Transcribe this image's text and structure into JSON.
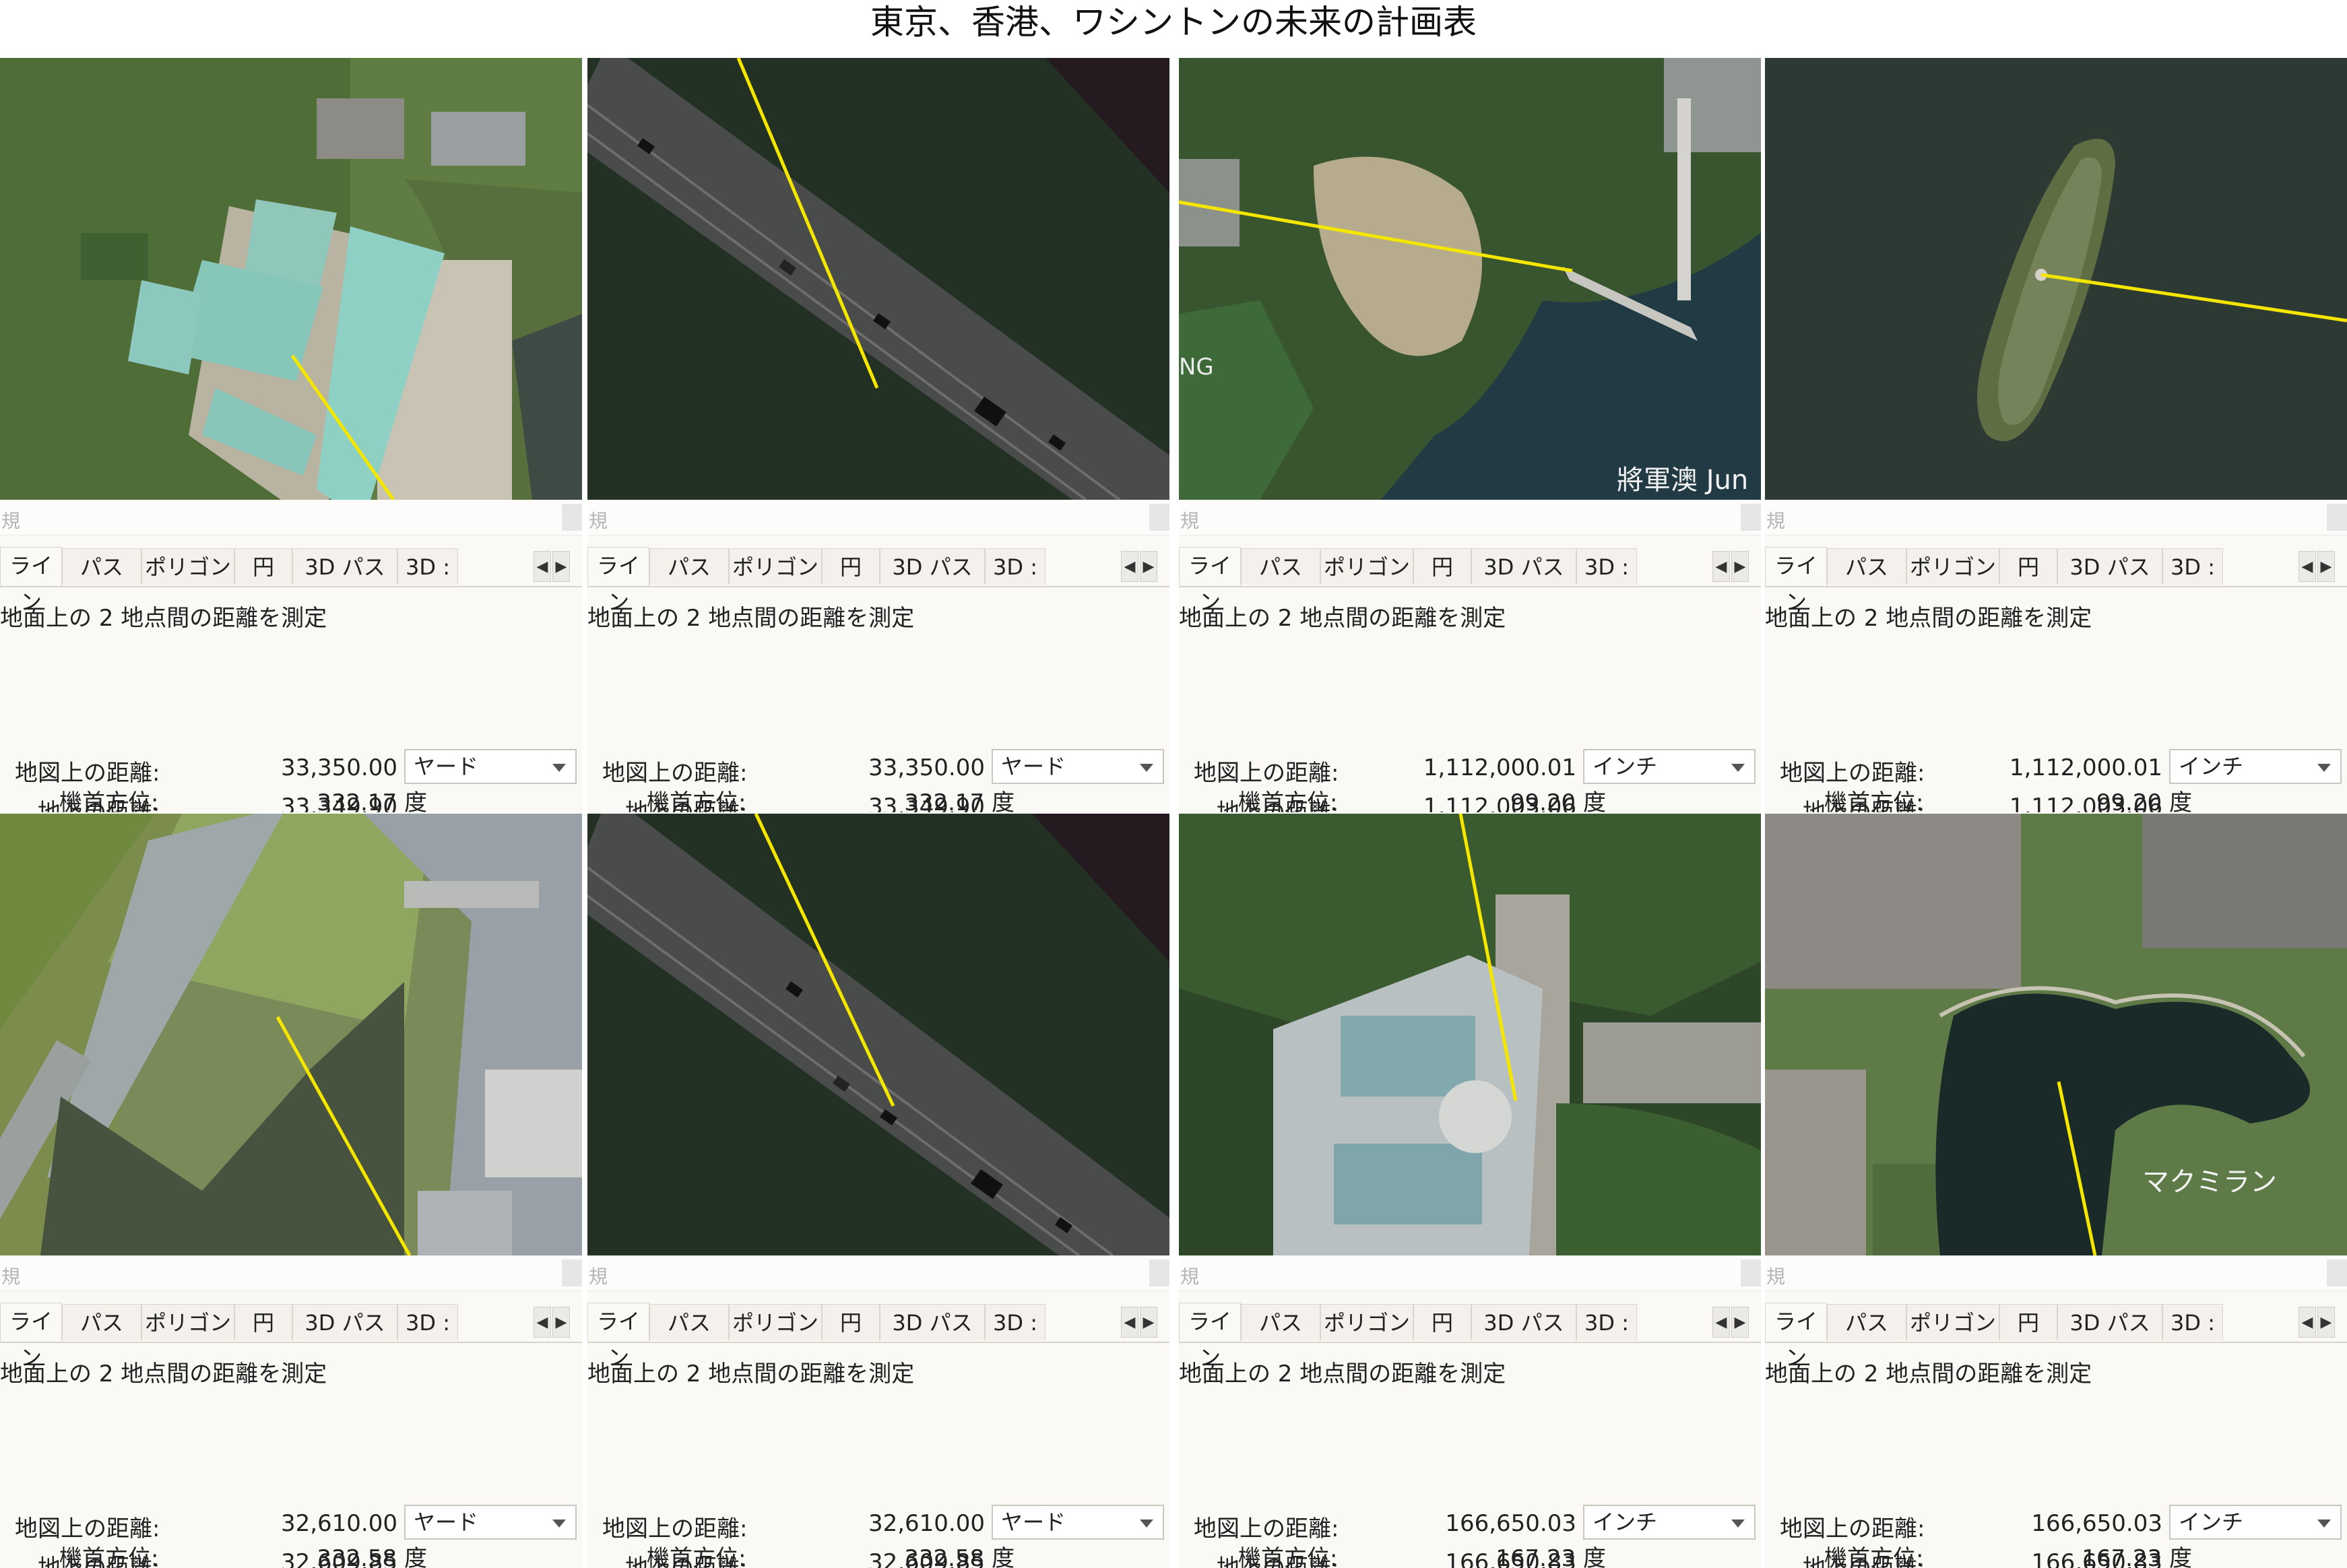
{
  "title": "東京、香港、ワシントンの未来の計画表",
  "ui": {
    "hint": "規",
    "tabs": [
      "ライン",
      "パス",
      "ポリゴン",
      "円",
      "3D パス",
      "3D :"
    ],
    "description": "地面上の 2 地点間の距離を測定",
    "map_length_label": "地図上の距離:",
    "ground_length_label": "地上の距離:",
    "heading_label": "機首方位:",
    "heading_unit": "度"
  },
  "colors": {
    "measure_line": "#f5e600",
    "water": "#243028"
  },
  "panels": [
    {
      "scene": "tokyo-palace",
      "map_length": "33,350.00",
      "unit": "ヤード",
      "ground_length": "33,349.90",
      "heading": "332.17"
    },
    {
      "scene": "bridge-1",
      "map_length": "33,350.00",
      "unit": "ヤード",
      "ground_length": "33,349.90",
      "heading": "332.17"
    },
    {
      "scene": "hongkong-bay",
      "map_length": "1,112,000.01",
      "unit": "インチ",
      "ground_length": "1,112,003.06",
      "heading": "99.20",
      "place_label": "將軍澳 Jun",
      "edge_label": "NG"
    },
    {
      "scene": "island",
      "map_length": "1,112,000.01",
      "unit": "インチ",
      "ground_length": "1,112,003.06",
      "heading": "99.20"
    },
    {
      "scene": "tokyo-park",
      "map_length": "32,610.00",
      "unit": "ヤード",
      "ground_length": "32,609.85",
      "heading": "332.58"
    },
    {
      "scene": "bridge-2",
      "map_length": "32,610.00",
      "unit": "ヤード",
      "ground_length": "32,609.85",
      "heading": "332.58"
    },
    {
      "scene": "capitol",
      "map_length": "166,650.03",
      "unit": "インチ",
      "ground_length": "166,650.83",
      "heading": "167.23"
    },
    {
      "scene": "mcmillan",
      "map_length": "166,650.03",
      "unit": "インチ",
      "ground_length": "166,650.83",
      "heading": "167.23",
      "place_label": "マクミラン"
    }
  ]
}
